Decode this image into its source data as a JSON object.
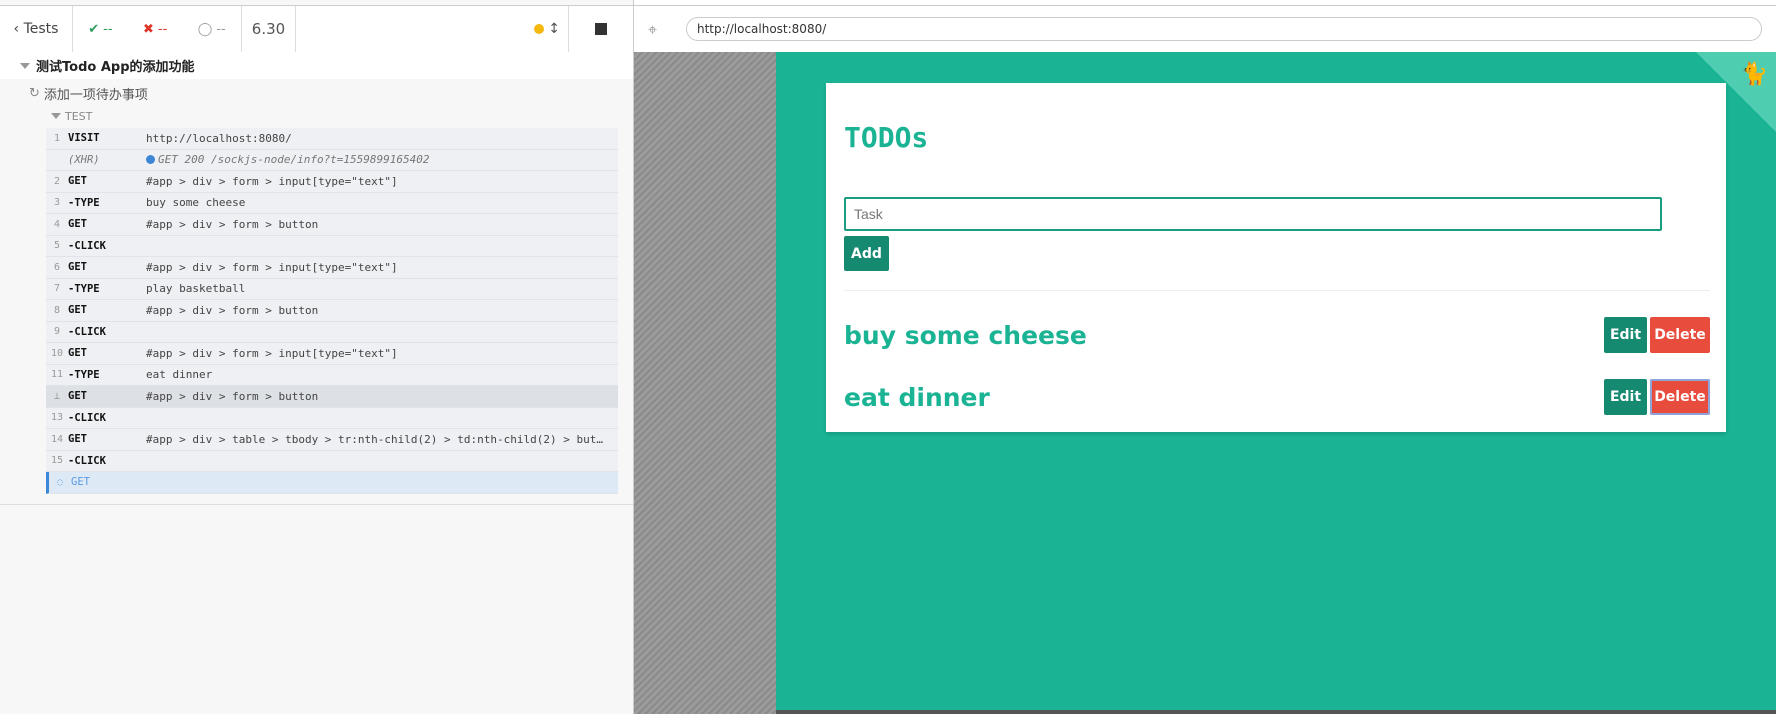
{
  "runner": {
    "back_label": "Tests",
    "passed": "--",
    "failed": "--",
    "pending": "--",
    "duration": "6.30"
  },
  "suite": {
    "title": "测试Todo App的添加功能",
    "test_title": "添加一项待办事项",
    "section": "TEST"
  },
  "commands": [
    {
      "num": "1",
      "name": "VISIT",
      "msg": "http://localhost:8080/"
    },
    {
      "num": "",
      "name": "(XHR)",
      "msg": "GET 200 /sockjs-node/info?t=1559899165402"
    },
    {
      "num": "2",
      "name": "GET",
      "msg": "#app > div > form > input[type=\"text\"]"
    },
    {
      "num": "3",
      "name": "-TYPE",
      "msg": "buy some cheese"
    },
    {
      "num": "4",
      "name": "GET",
      "msg": "#app > div > form > button"
    },
    {
      "num": "5",
      "name": "-CLICK",
      "msg": ""
    },
    {
      "num": "6",
      "name": "GET",
      "msg": "#app > div > form > input[type=\"text\"]"
    },
    {
      "num": "7",
      "name": "-TYPE",
      "msg": "play basketball"
    },
    {
      "num": "8",
      "name": "GET",
      "msg": "#app > div > form > button"
    },
    {
      "num": "9",
      "name": "-CLICK",
      "msg": ""
    },
    {
      "num": "10",
      "name": "GET",
      "msg": "#app > div > form > input[type=\"text\"]"
    },
    {
      "num": "11",
      "name": "-TYPE",
      "msg": "eat dinner"
    },
    {
      "num": "",
      "name": "GET",
      "msg": "#app > div > form > button"
    },
    {
      "num": "13",
      "name": "-CLICK",
      "msg": ""
    },
    {
      "num": "14",
      "name": "GET",
      "msg": "#app > div > table > tbody > tr:nth-child(2) > td:nth-child(2) > but…"
    },
    {
      "num": "15",
      "name": "-CLICK",
      "msg": ""
    },
    {
      "num": "",
      "name": "GET",
      "msg": ""
    }
  ],
  "browser": {
    "url": "http://localhost:8080/"
  },
  "app": {
    "title": "TODOs",
    "input_placeholder": "Task",
    "add_label": "Add",
    "edit_label": "Edit",
    "delete_label": "Delete",
    "todos": [
      "buy some cheese",
      "eat dinner"
    ]
  }
}
